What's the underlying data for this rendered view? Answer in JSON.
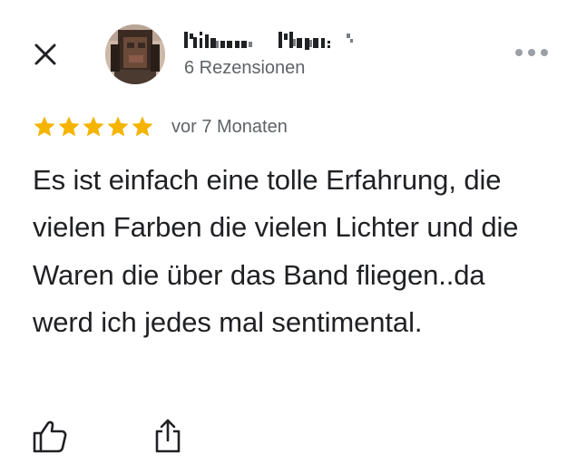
{
  "header": {
    "close_icon": "close-icon",
    "author_name": "Melissa Meyer",
    "review_count": "6 Rezensionen",
    "more_icon": "more-horizontal-icon"
  },
  "rating": {
    "stars": 5,
    "max_stars": 5,
    "star_color": "#f4b400",
    "date": "vor 7 Monaten"
  },
  "review": {
    "text": "Es ist einfach eine tolle Erfahrung, die vielen Farben die vielen Lichter und die Waren die über das Band fliegen..da werd ich jedes mal sentimental."
  },
  "actions": {
    "like_icon": "thumbs-up-icon",
    "share_icon": "share-icon"
  }
}
